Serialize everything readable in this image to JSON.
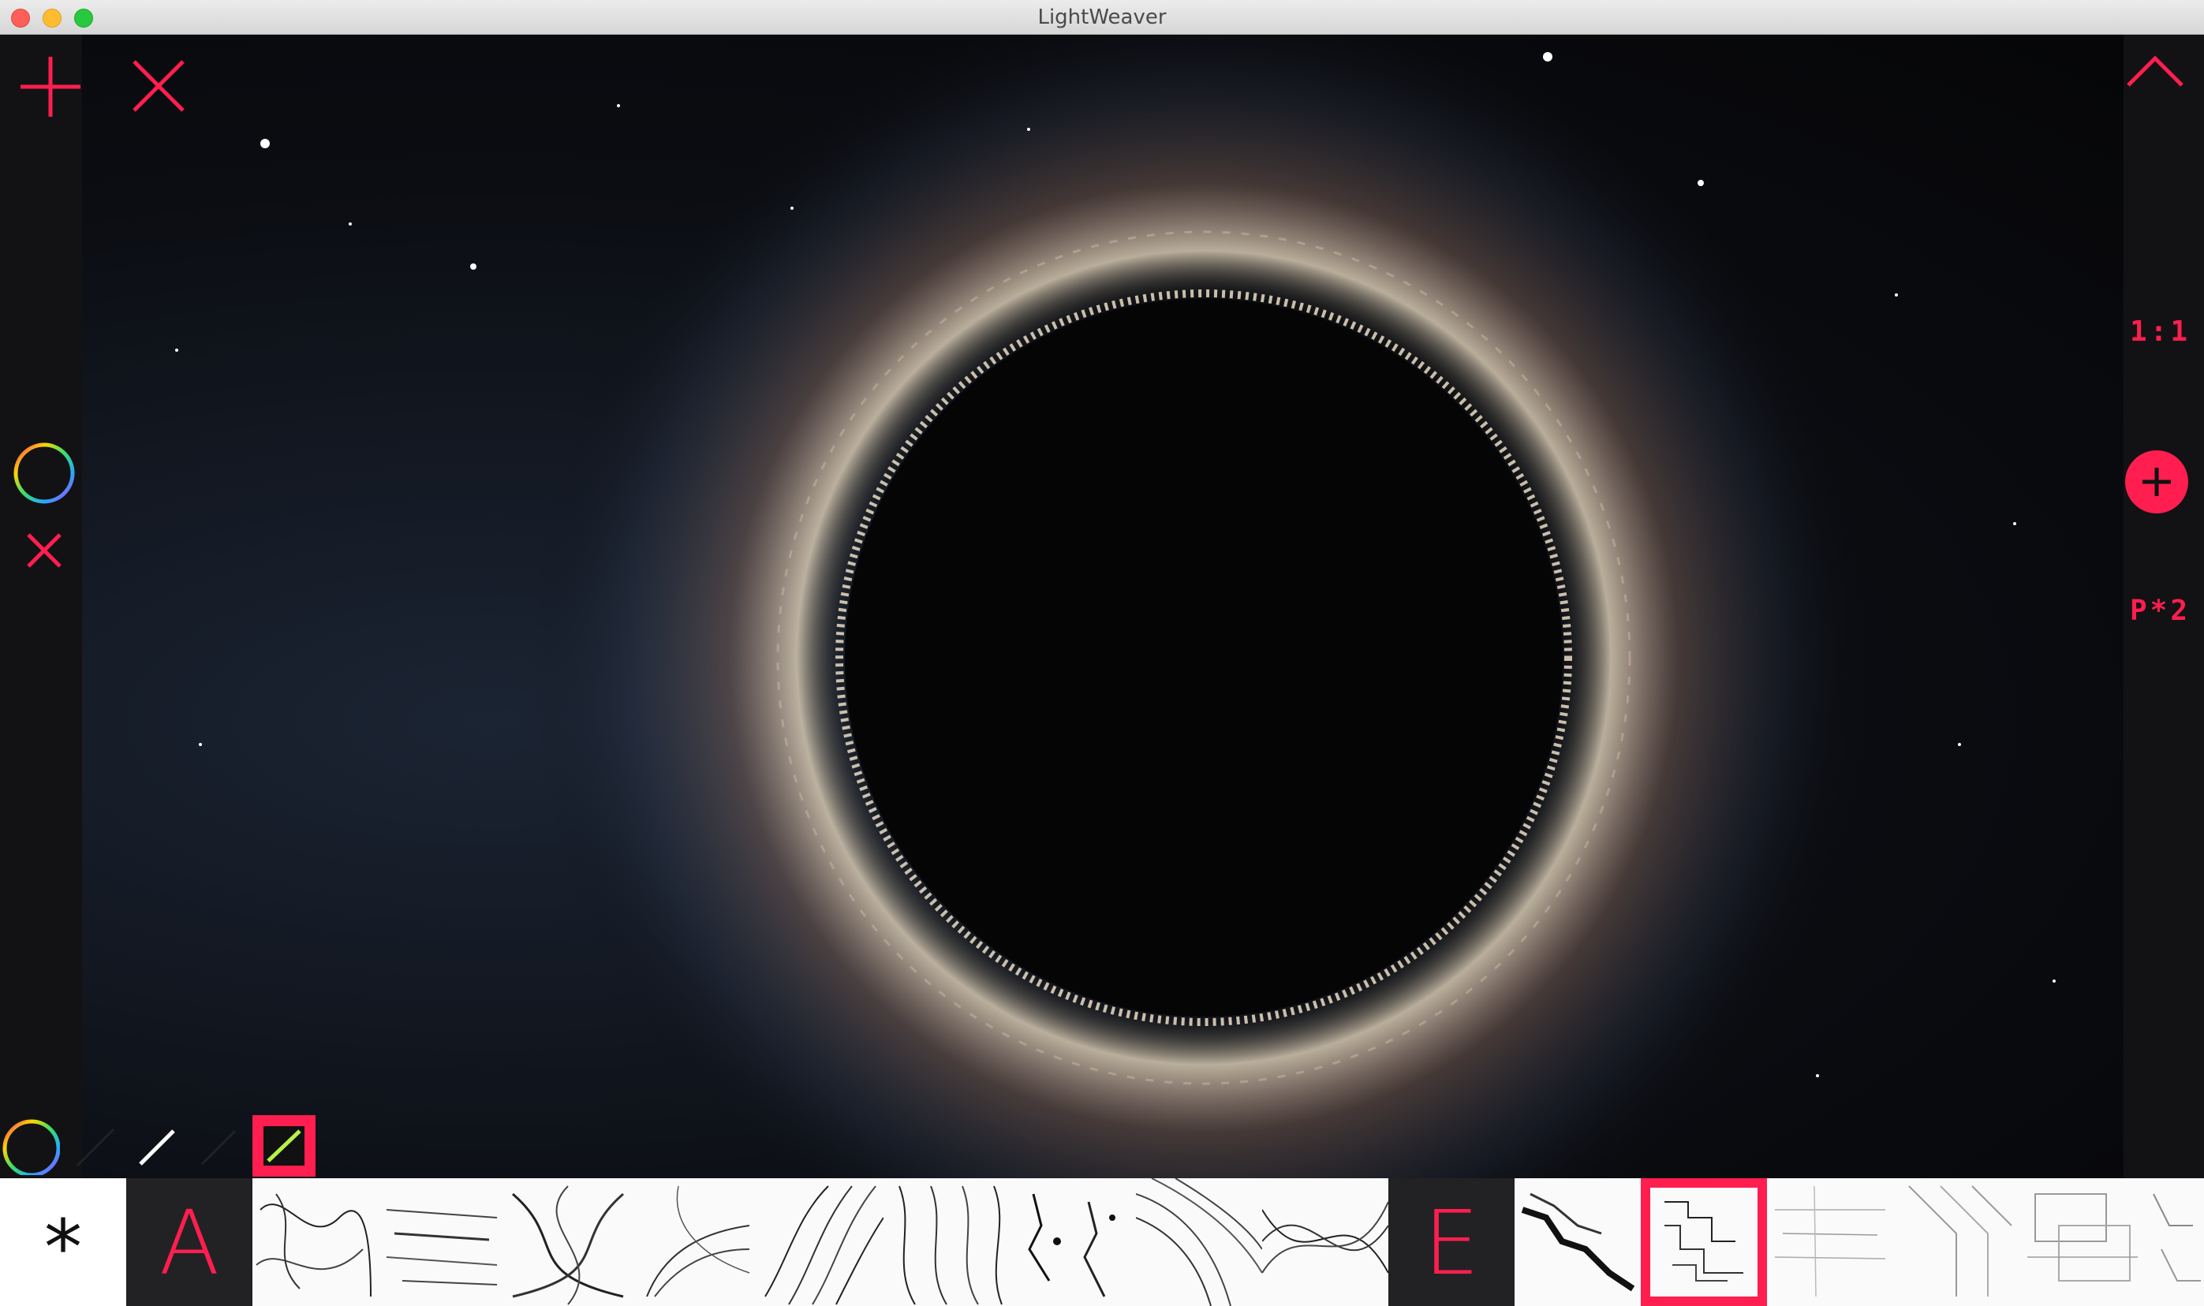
{
  "window": {
    "title": "LightWeaver"
  },
  "toolbar_right": {
    "ratio_label": "1:1",
    "pass_label": "P*2"
  },
  "left_tools": {
    "icons": [
      "plus-icon",
      "close-icon",
      "color-wheel-icon",
      "clear-color-icon"
    ]
  },
  "brush_row": {
    "swatches": [
      "color-wheel-icon",
      "thin-line-icon",
      "white-line-icon",
      "thin-line-icon",
      "active-line-icon"
    ]
  },
  "brush_strip": {
    "items": [
      {
        "kind": "symbol",
        "label": "*"
      },
      {
        "kind": "letter",
        "label": "A"
      },
      {
        "kind": "thumb"
      },
      {
        "kind": "thumb"
      },
      {
        "kind": "thumb"
      },
      {
        "kind": "thumb"
      },
      {
        "kind": "thumb"
      },
      {
        "kind": "thumb"
      },
      {
        "kind": "thumb"
      },
      {
        "kind": "thumb"
      },
      {
        "kind": "thumb"
      },
      {
        "kind": "letter",
        "label": "E"
      },
      {
        "kind": "thumb"
      },
      {
        "kind": "thumb",
        "selected": true
      },
      {
        "kind": "thumb"
      },
      {
        "kind": "thumb"
      },
      {
        "kind": "thumb"
      },
      {
        "kind": "thumb"
      }
    ]
  },
  "colors": {
    "accent": "#ff1e4f",
    "canvas_bg": "#0b0d12",
    "strip_bg": "#ffffff"
  }
}
